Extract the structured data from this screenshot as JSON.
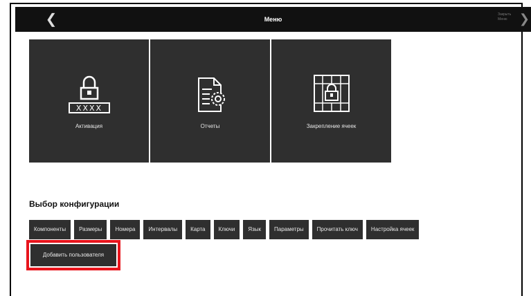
{
  "header": {
    "title": "Меню",
    "back_icon": "chevron-left-icon",
    "close_label": "Закрыть Меню",
    "close_icon": "chevron-right-icon"
  },
  "tiles": [
    {
      "label": "Активация",
      "icon": "lock-password-icon"
    },
    {
      "label": "Отчеты",
      "icon": "report-gear-icon"
    },
    {
      "label": "Закрепление ячеек",
      "icon": "locked-cells-icon"
    }
  ],
  "config": {
    "title": "Выбор конфигурации",
    "buttons": [
      "Компоненты",
      "Размеры",
      "Номера",
      "Интервалы",
      "Карта",
      "Ключи",
      "Язык",
      "Параметры",
      "Прочитать ключ",
      "Настройка ячеек"
    ],
    "add_user": "Добавить пользователя",
    "highlight_color": "#e8141c"
  }
}
